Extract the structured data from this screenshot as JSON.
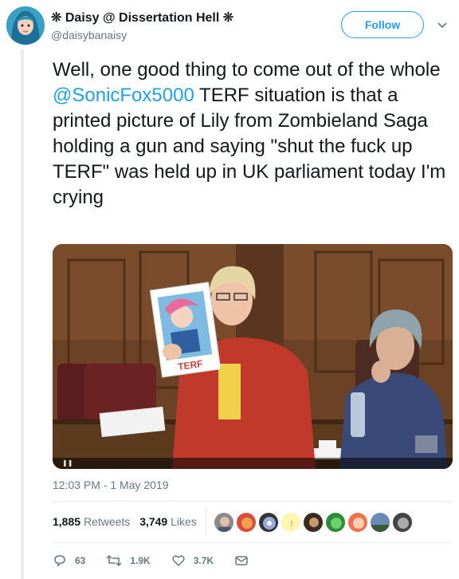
{
  "tweet": {
    "display_name": "Daisy @ Dissertation Hell",
    "name_decoration": "❊",
    "handle": "@daisybanaisy",
    "follow_label": "Follow",
    "text_before": "Well, one good thing to come out of the whole ",
    "mention": "@SonicFox5000",
    "text_after": " TERF situation is that a printed picture of Lily from Zombieland Saga holding a gun and saying \"shut the fuck up TERF\" was held up in UK parliament today I'm crying",
    "timestamp": "12:03 PM - 1 May 2019",
    "stats": {
      "retweets_count": "1,885",
      "retweets_label": "Retweets",
      "likes_count": "3,749",
      "likes_label": "Likes"
    },
    "actions": {
      "reply_count": "63",
      "retweet_count": "1.9K",
      "like_count": "3.7K"
    },
    "media": {
      "sign_text": "TERF"
    }
  },
  "colors": {
    "accent": "#1da1f2",
    "text": "#14171a",
    "muted": "#657786",
    "divider": "#e6ecf0"
  },
  "icons": [
    "chevron-down-icon",
    "reply-icon",
    "retweet-icon",
    "like-icon",
    "message-icon"
  ]
}
